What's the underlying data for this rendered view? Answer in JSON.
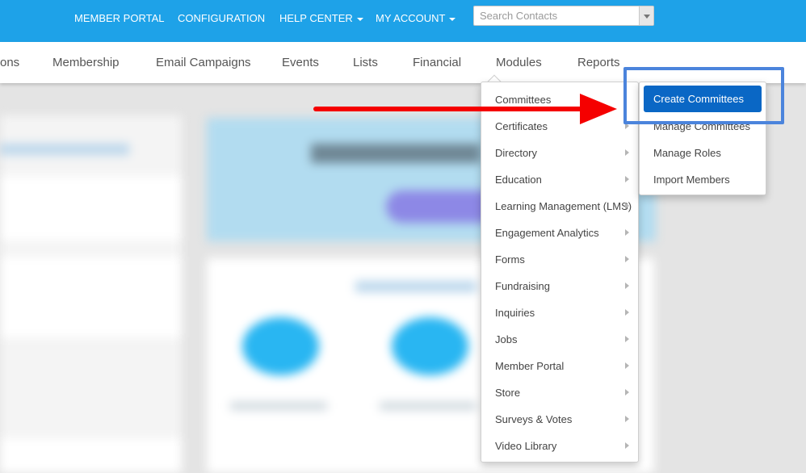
{
  "topbar": {
    "links": {
      "member_portal": "MEMBER PORTAL",
      "configuration": "CONFIGURATION",
      "help_center": "HELP CENTER",
      "my_account": "MY ACCOUNT"
    },
    "search": {
      "placeholder": "Search Contacts",
      "value": ""
    }
  },
  "nav": {
    "items": [
      "ons",
      "Membership",
      "Email Campaigns",
      "Events",
      "Lists",
      "Financial",
      "Modules",
      "Reports"
    ]
  },
  "modules_menu": {
    "items": [
      {
        "label": "Committees"
      },
      {
        "label": "Certificates"
      },
      {
        "label": "Directory"
      },
      {
        "label": "Education"
      },
      {
        "label": "Learning Management (LMS)"
      },
      {
        "label": "Engagement Analytics"
      },
      {
        "label": "Forms"
      },
      {
        "label": "Fundraising"
      },
      {
        "label": "Inquiries"
      },
      {
        "label": "Jobs"
      },
      {
        "label": "Member Portal"
      },
      {
        "label": "Store"
      },
      {
        "label": "Surveys & Votes"
      },
      {
        "label": "Video Library"
      }
    ]
  },
  "committees_submenu": {
    "items": [
      "Create Committees",
      "Manage Committees",
      "Manage Roles",
      "Import Members"
    ]
  },
  "colors": {
    "topbar": "#1ea2e8",
    "primary_button": "#0a67c5",
    "highlight": "#4b84dc",
    "arrow": "#f50000"
  },
  "icons": [
    "caret-down-icon",
    "chevron-right-icon",
    "red-arrow-icon"
  ]
}
